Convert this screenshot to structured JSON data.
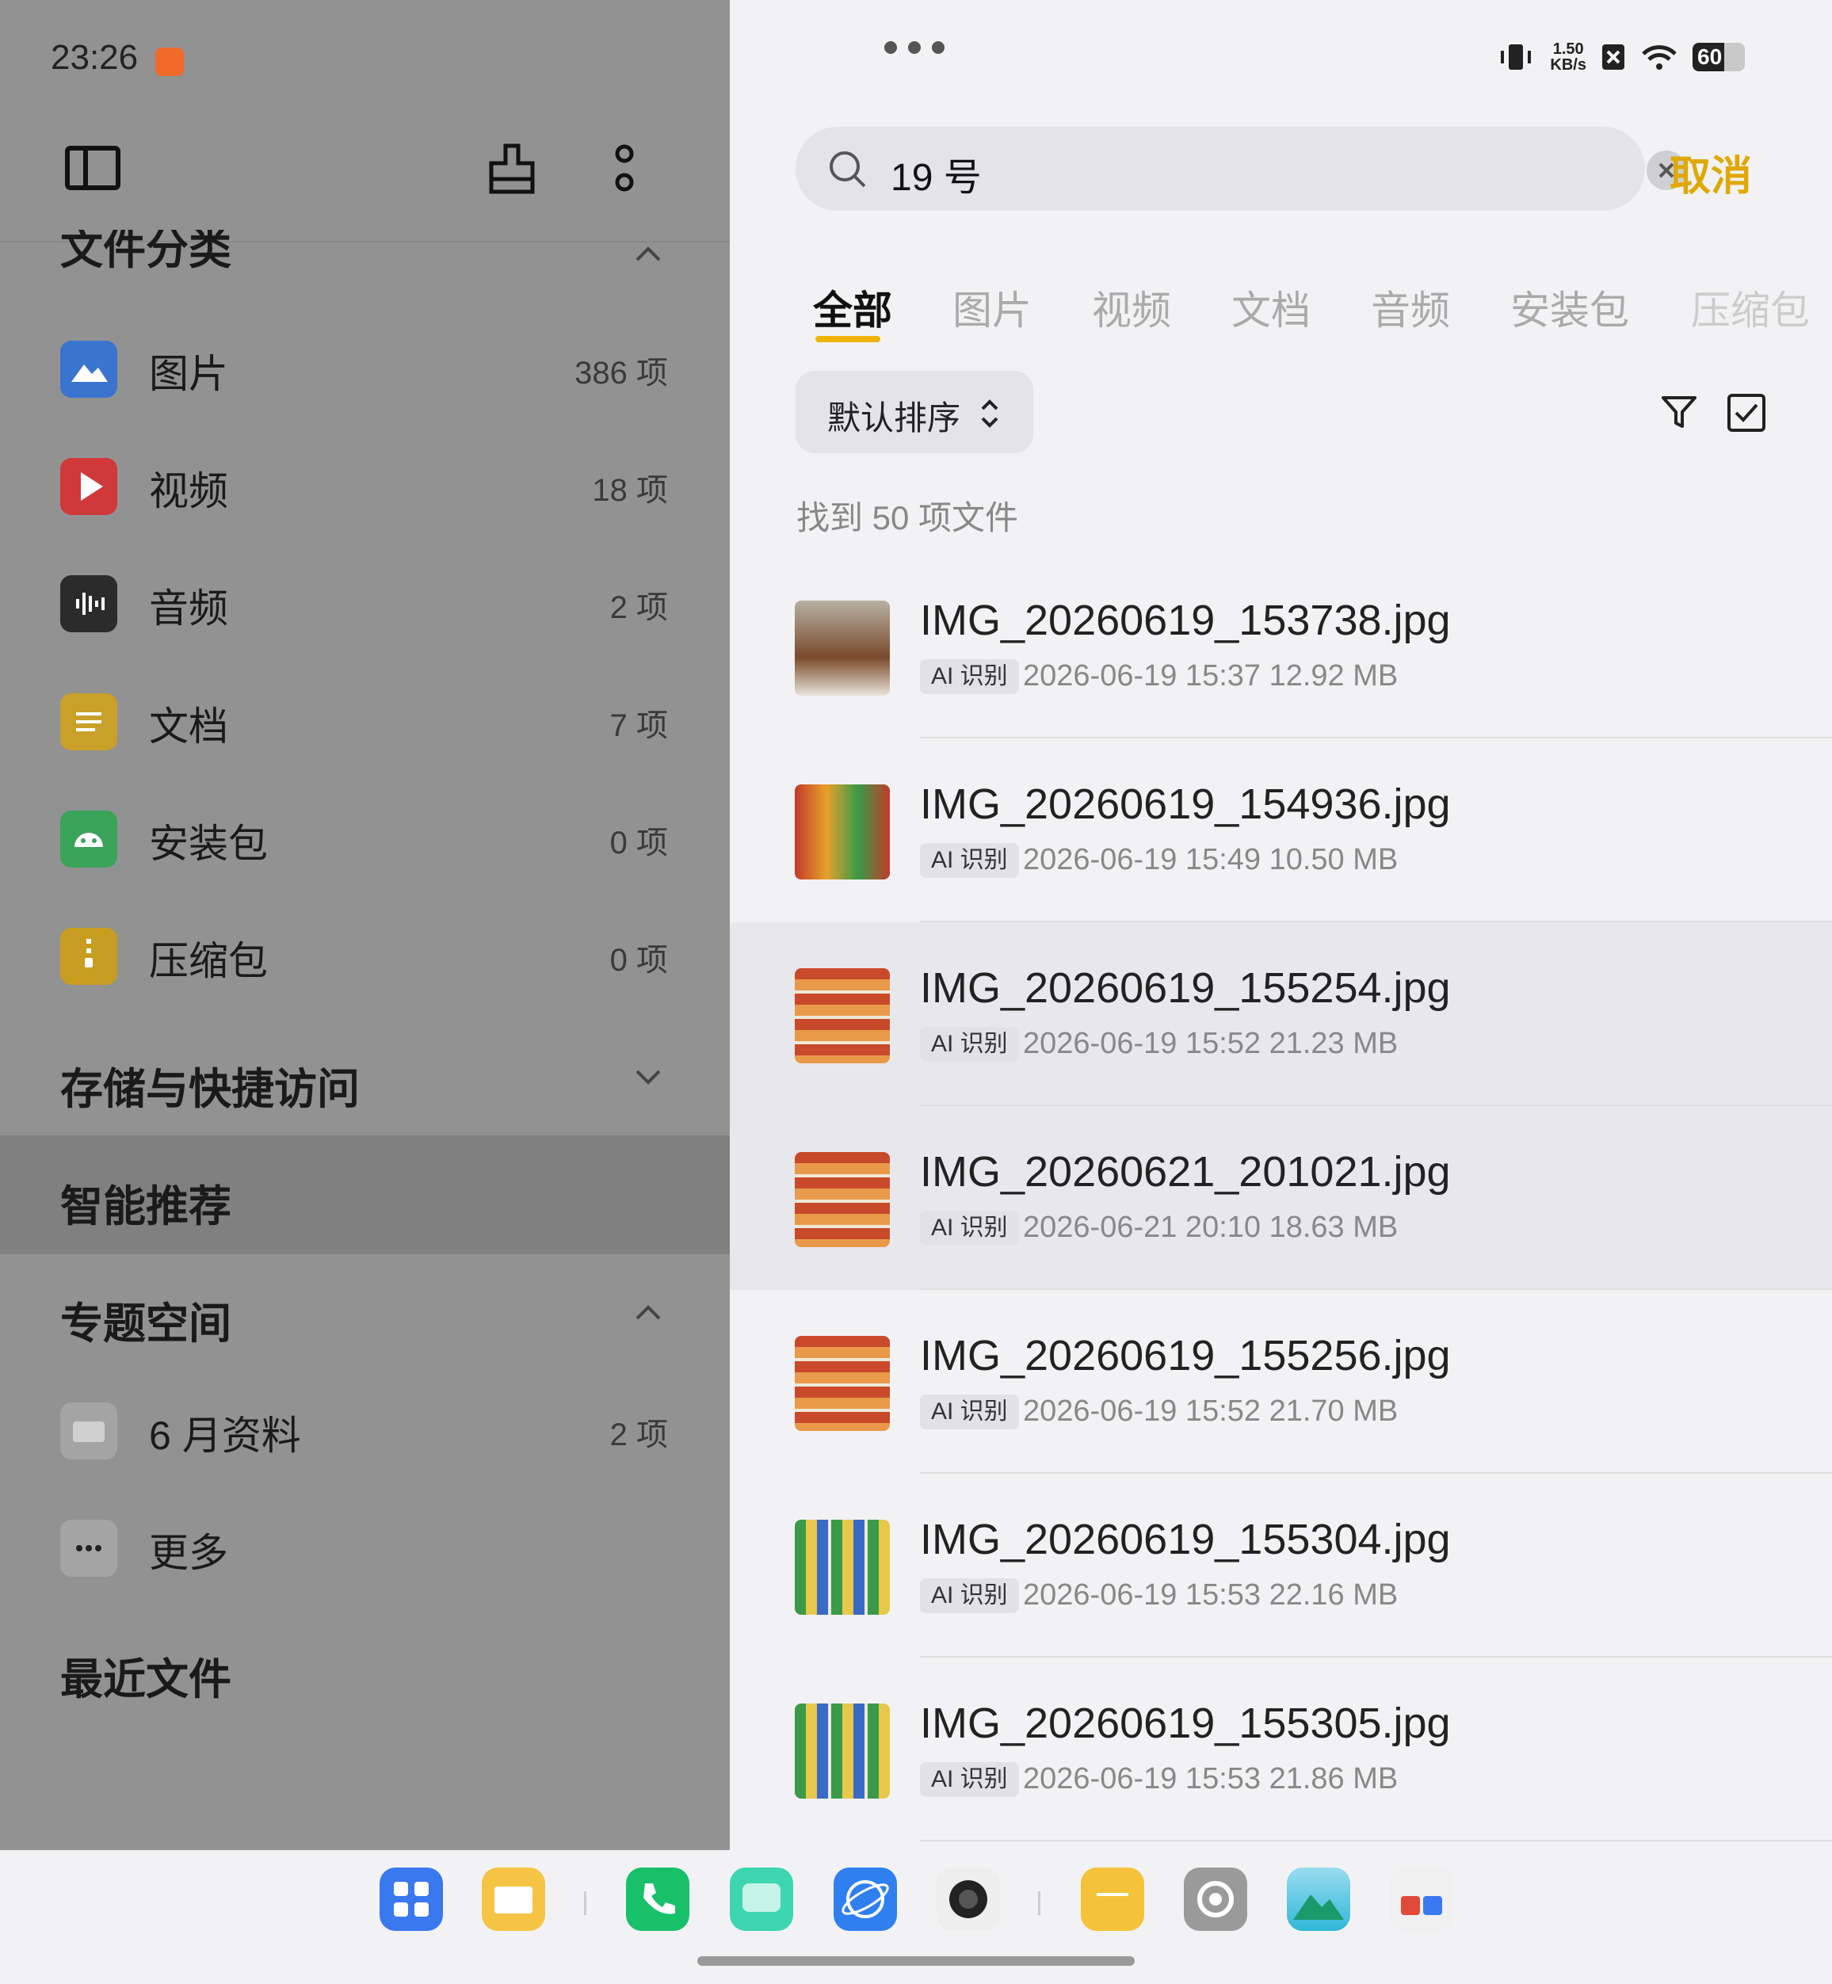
{
  "status": {
    "time": "23:26",
    "net_speed_value": "1.50",
    "net_speed_unit": "KB/s",
    "battery": "60"
  },
  "left": {
    "file_category_header": "文件分类",
    "categories": [
      {
        "label": "图片",
        "count": "386 项",
        "color": "#3a74cf"
      },
      {
        "label": "视频",
        "count": "18 项",
        "color": "#d0393a"
      },
      {
        "label": "音频",
        "count": "2 项",
        "color": "#2b2b2b"
      },
      {
        "label": "文档",
        "count": "7 项",
        "color": "#c9a02a"
      },
      {
        "label": "安装包",
        "count": "0 项",
        "color": "#3aa35a"
      },
      {
        "label": "压缩包",
        "count": "0 项",
        "color": "#c89e22"
      }
    ],
    "storage_header": "存储与快捷访问",
    "smart_header": "智能推荐",
    "topic_header": "专题空间",
    "topics": [
      {
        "label": "6 月资料",
        "count": "2 项"
      },
      {
        "label": "更多",
        "count": ""
      }
    ],
    "recent_header": "最近文件"
  },
  "search": {
    "query": "19 号",
    "cancel": "取消"
  },
  "tabs": [
    "全部",
    "图片",
    "视频",
    "文档",
    "音频",
    "安装包",
    "压缩包"
  ],
  "sort": {
    "label": "默认排序"
  },
  "found_text": "找到 50 项文件",
  "files": [
    {
      "name": "IMG_20260619_153738.jpg",
      "tag": "AI 识别",
      "meta": "2026-06-19 15:37    12.92 MB"
    },
    {
      "name": "IMG_20260619_154936.jpg",
      "tag": "AI 识别",
      "meta": "2026-06-19 15:49    10.50 MB"
    },
    {
      "name": "IMG_20260619_155254.jpg",
      "tag": "AI 识别",
      "meta": "2026-06-19 15:52    21.23 MB"
    },
    {
      "name": "IMG_20260621_201021.jpg",
      "tag": "AI 识别",
      "meta": "2026-06-21 20:10    18.63 MB"
    },
    {
      "name": "IMG_20260619_155256.jpg",
      "tag": "AI 识别",
      "meta": "2026-06-19 15:52    21.70 MB"
    },
    {
      "name": "IMG_20260619_155304.jpg",
      "tag": "AI 识别",
      "meta": "2026-06-19 15:53    22.16 MB"
    },
    {
      "name": "IMG_20260619_155305.jpg",
      "tag": "AI 识别",
      "meta": "2026-06-19 15:53    21.86 MB"
    }
  ],
  "dock": [
    {
      "icon": "app-store-icon",
      "color": "#3a78f0"
    },
    {
      "icon": "files-icon",
      "color": "#f6c445"
    },
    {
      "icon": "phone-icon",
      "color": "#18c06a"
    },
    {
      "icon": "messages-icon",
      "color": "#3dd6b0"
    },
    {
      "icon": "browser-icon",
      "color": "#2f7ff0"
    },
    {
      "icon": "camera-icon",
      "color": "#222222"
    },
    {
      "icon": "notes-icon",
      "color": "#f5c33a"
    },
    {
      "icon": "settings-icon",
      "color": "#9a9a9a"
    },
    {
      "icon": "gallery-icon",
      "color": "#2fb8d8"
    },
    {
      "icon": "news-icon",
      "color": "#f0f0f0"
    }
  ]
}
